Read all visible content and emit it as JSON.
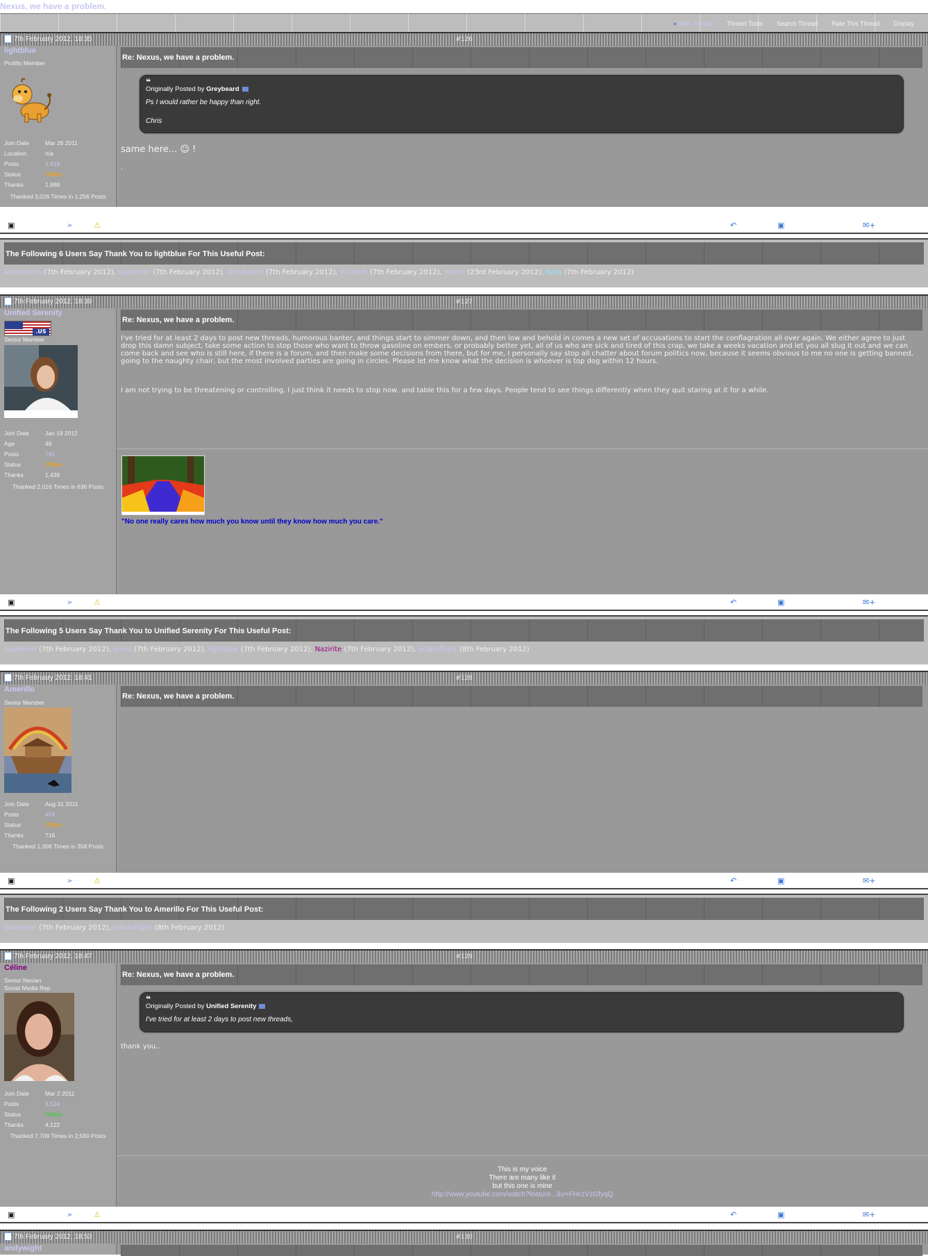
{
  "thread": {
    "title": "Nexus, we have a problem.",
    "tools": [
      "Next Thread",
      "Thread Tools",
      "Search Thread",
      "Rate This Thread",
      "Display"
    ]
  },
  "labels": {
    "join_date": "Join Date",
    "location": "Location",
    "age": "Age",
    "posts": "Posts",
    "status": "Status",
    "thanks": "Thanks",
    "originally_posted_by": "Originally Posted by"
  },
  "posts": [
    {
      "date": "7th February 2012, 18:35",
      "number": "#126",
      "user": "lightblue",
      "user_title": "Prolific Member",
      "join_date": "Mar 26 2011",
      "location": "n/a",
      "posts": "1,819",
      "status": "Offline",
      "thanks": "1,888",
      "thanked": "Thanked 3,026 Times in 1,256 Posts",
      "title": "Re: Nexus, we have a problem.",
      "quote_author": "Greybeard",
      "quote_line1": "Ps I would rather be happy than right.",
      "quote_line2": "Chris",
      "body": "same here... ☺ !",
      "body_extra": "."
    },
    {
      "date": "7th February 2012, 18:39",
      "number": "#127",
      "user": "Unified Serenity",
      "user_title": "Senior Member",
      "flag_tag": ".US",
      "join_date": "Jan 19 2012",
      "age": "46",
      "posts": "795",
      "status": "Offline",
      "thanks": "1,439",
      "thanked": "Thanked 2,016 Times in 636 Posts",
      "title": "Re: Nexus, we have a problem.",
      "body_p1": "I've tried for at least 2 days to post new threads, humorous banter, and things start to simmer down, and then low and behold in comes a new set of accusations to start the conflagration all over again. We either agree to just drop this damn subject, take some action to stop those who want to throw gasoline on embers, or probably better yet, all of us who are sick and tired of this crap, we take a weeks vacation and let you all slug it out and we can come back and see who is still here, if there is a forum, and then make some decisions from there, but for me, I personally say stop all chatter about forum politics now, because it seems obvious to me no one is getting banned, going to the naughty chair, but the most involved parties are going in circles. Please let me know what the decision is whoever is top dog within 12 hours.",
      "body_p2": "I am not trying to be threatening or controlling, I just think it needs to stop now, and table this for a few days. People tend to see things differently when they quit staring at it for a while.",
      "signature": "\"No one really cares how much you know until they know how much you care.\""
    },
    {
      "date": "7th February 2012, 18:41",
      "number": "#128",
      "user": "Amerillo",
      "user_title": "Senior Member",
      "join_date": "Aug 31 2011",
      "posts": "459",
      "status": "Offline",
      "thanks": "716",
      "thanked": "Thanked 1,008 Times in 358 Posts",
      "title": "Re: Nexus, we have a problem."
    },
    {
      "date": "7th February 2012, 18:47",
      "number": "#129",
      "user": "Céline",
      "user_title": "Senior Nexian",
      "user_title2": "Social Media Rep",
      "join_date": "Mar 2 2011",
      "posts": "3,524",
      "status": "Online",
      "thanks": "4,122",
      "thanked": "Thanked 7,709 Times in 2,560 Posts",
      "title": "Re: Nexus, we have a problem.",
      "quote_author": "Unified Serenity",
      "quote_line1": "I've tried for at least 2 days to post new threads,",
      "body": "thank you..",
      "sig_line1": "This is my voice",
      "sig_line2": "There are many like it",
      "sig_line3": "but this one is mine",
      "sig_link": "http://www.youtube.com/watch?feature...&v=FHczVzGfyqQ"
    },
    {
      "date": "7th February 2012, 18:53",
      "number": "#130",
      "user": "andywight"
    }
  ],
  "thanks_sections": [
    {
      "heading": "The Following 6 Users Say Thank You to lightblue For This Useful Post:",
      "entries": [
        {
          "name": "Akhenaten",
          "date": " (7th February 2012), "
        },
        {
          "name": "Gardener",
          "date": " (7th February 2012), "
        },
        {
          "name": "Greybeard",
          "date": " (7th February 2012), "
        },
        {
          "name": "InCiDeR",
          "date": " (7th February 2012), "
        },
        {
          "name": "noxon",
          "date": " (23rd February 2012), "
        },
        {
          "name": "Ross",
          "date": " (7th February 2012)"
        }
      ]
    },
    {
      "heading": "The Following 5 Users Say Thank You to Unified Serenity For This Useful Post:",
      "entries": [
        {
          "name": "Gardener",
          "date": " (7th February 2012), "
        },
        {
          "name": "Janos",
          "date": " (7th February 2012), "
        },
        {
          "name": "lightblue",
          "date": " (7th February 2012), "
        },
        {
          "name": "Nazirite",
          "date": " (7th February 2012), "
        },
        {
          "name": "pillaroflight",
          "date": " (8th February 2012)"
        }
      ]
    },
    {
      "heading": "The Following 2 Users Say Thank You to Amerillo For This Useful Post:",
      "entries": [
        {
          "name": "Gardener",
          "date": " (7th February 2012), "
        },
        {
          "name": "pillaroflight",
          "date": " (8th February 2012)"
        }
      ]
    }
  ],
  "colors": {
    "link": "#c8c8f5",
    "offline": "#ffa500",
    "online": "#2fd12f",
    "signature_blue": "#0000cc"
  }
}
